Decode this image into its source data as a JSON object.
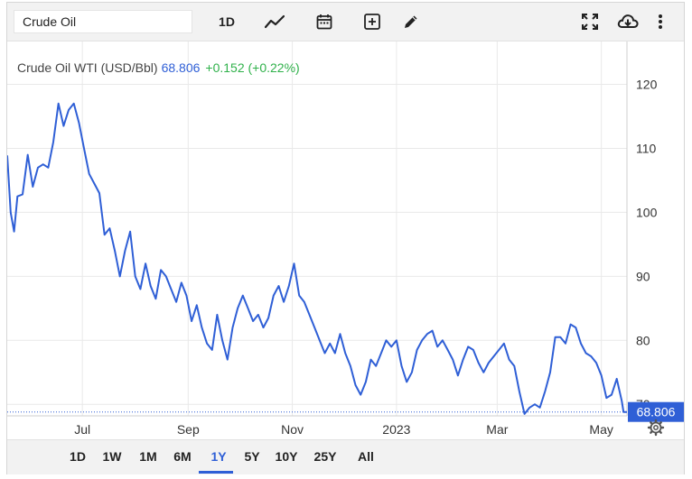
{
  "toolbar": {
    "search_value": "Crude Oil",
    "interval_label": "1D",
    "icons": [
      "line-chart-icon",
      "calendar-icon",
      "add-indicator-icon",
      "draw-pencil-icon",
      "fullscreen-icon",
      "download-cloud-icon",
      "more-vertical-icon"
    ]
  },
  "legend": {
    "name": "Crude Oil WTI (USD/Bbl)",
    "price": "68.806",
    "change": "+0.152 (+0.22%)"
  },
  "price_tag": "68.806",
  "range_buttons": [
    "1D",
    "1W",
    "1M",
    "6M",
    "1Y",
    "5Y",
    "10Y",
    "25Y",
    "All"
  ],
  "active_range": "1Y",
  "colors": {
    "line": "#2f5fd6",
    "positive": "#2fb14a",
    "grid": "#e9e9e9"
  },
  "chart_data": {
    "type": "line",
    "title": "",
    "xlabel": "",
    "ylabel": "",
    "x_range": [
      "2022-05-18",
      "2023-05-16"
    ],
    "ylim": [
      68.2,
      126.7
    ],
    "y_ticks": [
      70,
      80,
      90,
      100,
      110,
      120
    ],
    "x_ticks": [
      {
        "date": "2022-07-01",
        "label": "Jul"
      },
      {
        "date": "2022-09-01",
        "label": "Sep"
      },
      {
        "date": "2022-11-01",
        "label": "Nov"
      },
      {
        "date": "2023-01-01",
        "label": "2023"
      },
      {
        "date": "2023-03-01",
        "label": "Mar"
      },
      {
        "date": "2023-05-01",
        "label": "May"
      }
    ],
    "grid": true,
    "last_value": 68.806,
    "series": [
      {
        "name": "",
        "color": "#2f5fd6",
        "points": [
          [
            "2022-05-18",
            108.9
          ],
          [
            "2022-05-20",
            100.0
          ],
          [
            "2022-05-22",
            97.0
          ],
          [
            "2022-05-24",
            102.5
          ],
          [
            "2022-05-27",
            102.8
          ],
          [
            "2022-05-30",
            109.0
          ],
          [
            "2022-06-02",
            104.0
          ],
          [
            "2022-06-05",
            107.0
          ],
          [
            "2022-06-08",
            107.5
          ],
          [
            "2022-06-11",
            107.0
          ],
          [
            "2022-06-14",
            111.0
          ],
          [
            "2022-06-17",
            117.0
          ],
          [
            "2022-06-20",
            113.5
          ],
          [
            "2022-06-23",
            116.0
          ],
          [
            "2022-06-26",
            117.0
          ],
          [
            "2022-06-29",
            114.0
          ],
          [
            "2022-07-02",
            110.0
          ],
          [
            "2022-07-05",
            106.0
          ],
          [
            "2022-07-08",
            104.5
          ],
          [
            "2022-07-11",
            103.0
          ],
          [
            "2022-07-14",
            96.5
          ],
          [
            "2022-07-17",
            97.5
          ],
          [
            "2022-07-20",
            94.0
          ],
          [
            "2022-07-23",
            90.0
          ],
          [
            "2022-07-26",
            94.0
          ],
          [
            "2022-07-29",
            97.0
          ],
          [
            "2022-08-01",
            90.0
          ],
          [
            "2022-08-04",
            88.0
          ],
          [
            "2022-08-07",
            92.0
          ],
          [
            "2022-08-10",
            88.5
          ],
          [
            "2022-08-13",
            86.5
          ],
          [
            "2022-08-16",
            91.0
          ],
          [
            "2022-08-19",
            90.0
          ],
          [
            "2022-08-22",
            88.0
          ],
          [
            "2022-08-25",
            86.0
          ],
          [
            "2022-08-28",
            89.0
          ],
          [
            "2022-08-31",
            87.0
          ],
          [
            "2022-09-03",
            83.0
          ],
          [
            "2022-09-06",
            85.5
          ],
          [
            "2022-09-09",
            82.0
          ],
          [
            "2022-09-12",
            79.5
          ],
          [
            "2022-09-15",
            78.5
          ],
          [
            "2022-09-18",
            84.0
          ],
          [
            "2022-09-21",
            80.0
          ],
          [
            "2022-09-24",
            77.0
          ],
          [
            "2022-09-27",
            82.0
          ],
          [
            "2022-09-30",
            85.0
          ],
          [
            "2022-10-03",
            87.0
          ],
          [
            "2022-10-06",
            85.0
          ],
          [
            "2022-10-09",
            83.0
          ],
          [
            "2022-10-12",
            84.0
          ],
          [
            "2022-10-15",
            82.0
          ],
          [
            "2022-10-18",
            83.5
          ],
          [
            "2022-10-21",
            87.0
          ],
          [
            "2022-10-24",
            88.5
          ],
          [
            "2022-10-27",
            86.0
          ],
          [
            "2022-10-30",
            88.5
          ],
          [
            "2022-11-02",
            92.0
          ],
          [
            "2022-11-05",
            87.0
          ],
          [
            "2022-11-08",
            86.0
          ],
          [
            "2022-11-11",
            84.0
          ],
          [
            "2022-11-14",
            82.0
          ],
          [
            "2022-11-17",
            80.0
          ],
          [
            "2022-11-20",
            78.0
          ],
          [
            "2022-11-23",
            79.5
          ],
          [
            "2022-11-26",
            78.0
          ],
          [
            "2022-11-29",
            81.0
          ],
          [
            "2022-12-02",
            78.0
          ],
          [
            "2022-12-05",
            76.0
          ],
          [
            "2022-12-08",
            73.0
          ],
          [
            "2022-12-11",
            71.5
          ],
          [
            "2022-12-14",
            73.5
          ],
          [
            "2022-12-17",
            77.0
          ],
          [
            "2022-12-20",
            76.0
          ],
          [
            "2022-12-23",
            78.0
          ],
          [
            "2022-12-26",
            80.0
          ],
          [
            "2022-12-29",
            79.0
          ],
          [
            "2023-01-01",
            80.0
          ],
          [
            "2023-01-04",
            76.0
          ],
          [
            "2023-01-07",
            73.5
          ],
          [
            "2023-01-10",
            75.0
          ],
          [
            "2023-01-13",
            78.5
          ],
          [
            "2023-01-16",
            80.0
          ],
          [
            "2023-01-19",
            81.0
          ],
          [
            "2023-01-22",
            81.5
          ],
          [
            "2023-01-25",
            79.0
          ],
          [
            "2023-01-28",
            80.0
          ],
          [
            "2023-01-31",
            78.5
          ],
          [
            "2023-02-03",
            77.0
          ],
          [
            "2023-02-06",
            74.5
          ],
          [
            "2023-02-09",
            77.0
          ],
          [
            "2023-02-12",
            79.0
          ],
          [
            "2023-02-15",
            78.5
          ],
          [
            "2023-02-18",
            76.5
          ],
          [
            "2023-02-21",
            75.0
          ],
          [
            "2023-02-24",
            76.5
          ],
          [
            "2023-02-27",
            77.5
          ],
          [
            "2023-03-02",
            78.5
          ],
          [
            "2023-03-05",
            79.5
          ],
          [
            "2023-03-08",
            77.0
          ],
          [
            "2023-03-11",
            76.0
          ],
          [
            "2023-03-14",
            72.0
          ],
          [
            "2023-03-17",
            68.5
          ],
          [
            "2023-03-20",
            69.5
          ],
          [
            "2023-03-23",
            70.0
          ],
          [
            "2023-03-26",
            69.5
          ],
          [
            "2023-03-29",
            72.0
          ],
          [
            "2023-04-01",
            75.0
          ],
          [
            "2023-04-04",
            80.5
          ],
          [
            "2023-04-07",
            80.5
          ],
          [
            "2023-04-10",
            79.5
          ],
          [
            "2023-04-13",
            82.5
          ],
          [
            "2023-04-16",
            82.0
          ],
          [
            "2023-04-19",
            79.5
          ],
          [
            "2023-04-22",
            78.0
          ],
          [
            "2023-04-25",
            77.5
          ],
          [
            "2023-04-28",
            76.5
          ],
          [
            "2023-05-01",
            74.5
          ],
          [
            "2023-05-04",
            71.0
          ],
          [
            "2023-05-07",
            71.5
          ],
          [
            "2023-05-10",
            74.0
          ],
          [
            "2023-05-13",
            70.5
          ],
          [
            "2023-05-14",
            68.8
          ],
          [
            "2023-05-16",
            68.806
          ]
        ]
      }
    ]
  }
}
